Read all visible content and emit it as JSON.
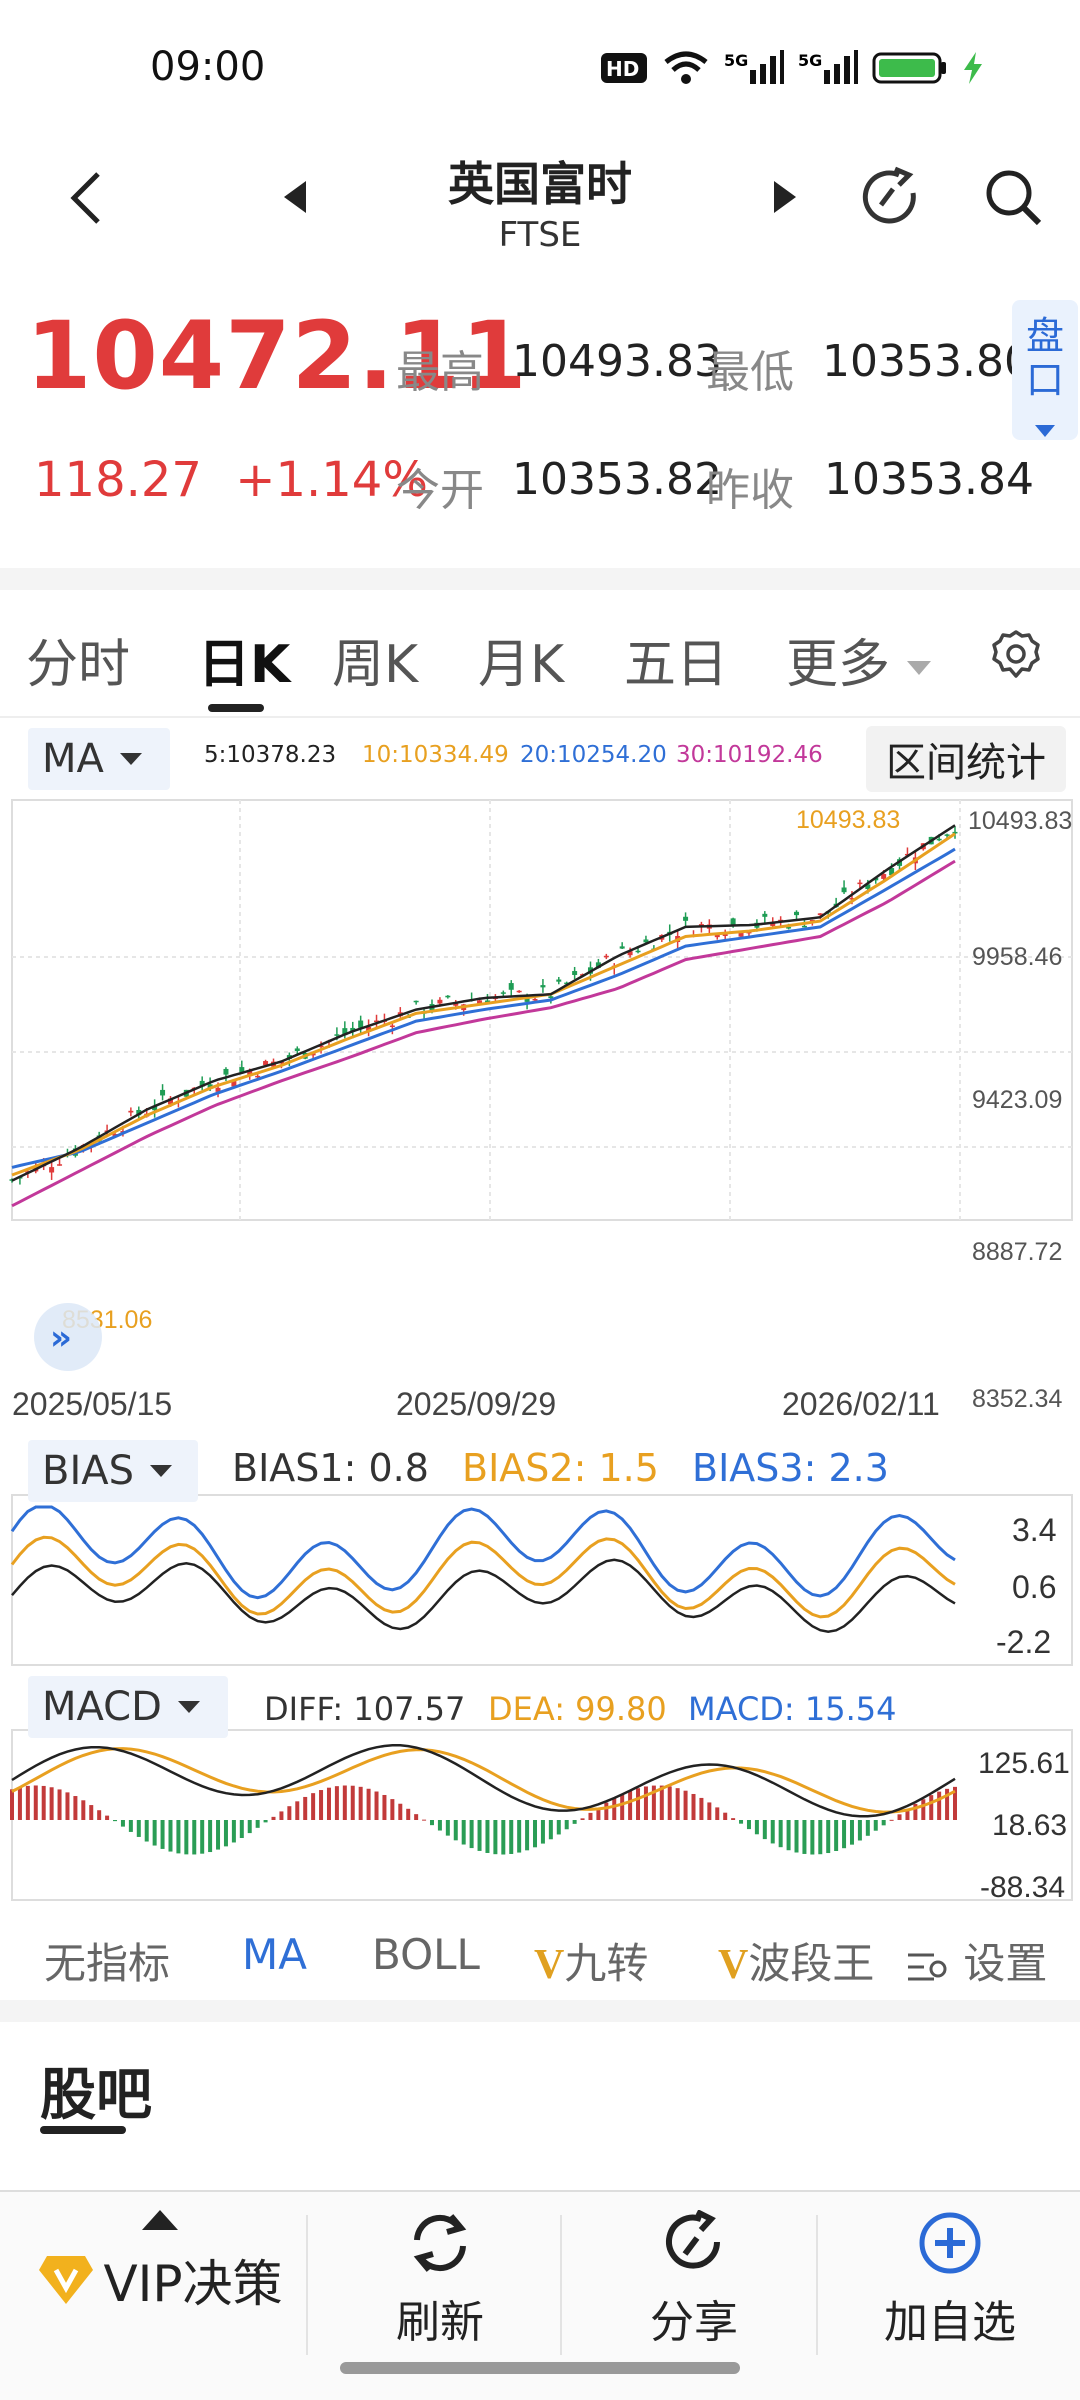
{
  "status_bar": {
    "time": "09:00",
    "hd_label": "HD",
    "net1": "5G",
    "net2": "5G",
    "icons": [
      "hd-icon",
      "wifi-icon",
      "signal-icon",
      "signal-icon",
      "battery-icon",
      "charging-icon"
    ]
  },
  "header": {
    "title": "英国富时",
    "subtitle": "FTSE",
    "icons": [
      "back-icon",
      "prev-icon",
      "next-icon",
      "share-refresh-icon",
      "search-icon"
    ]
  },
  "quote": {
    "price": "10472.11",
    "change": "118.27",
    "change_pct": "+1.14%",
    "high_label": "最高",
    "high": "10493.83",
    "low_label": "最低",
    "low": "10353.80",
    "open_label": "今开",
    "open": "10353.82",
    "prev_close_label": "昨收",
    "prev_close": "10353.84",
    "pankou_label": "盘口",
    "up_color": "#e03b3b"
  },
  "tabs": [
    "分时",
    "日K",
    "周K",
    "月K",
    "五日",
    "更多"
  ],
  "active_tab": "日K",
  "ma_header": {
    "selector": "MA",
    "ma5": "5:10378.23",
    "ma10": "10:10334.49",
    "ma20": "20:10254.20",
    "ma30": "30:10192.46",
    "range_button": "区间统计",
    "colors": {
      "ma5": "#222222",
      "ma10": "#e8a020",
      "ma20": "#2f6fd6",
      "ma30": "#c2389a"
    }
  },
  "kline": {
    "y_ticks": [
      "10493.83",
      "9958.46",
      "9423.09",
      "8887.72",
      "8352.34"
    ],
    "dates": [
      "2025/05/15",
      "2025/09/29",
      "2026/02/11"
    ],
    "max_label": "10493.83",
    "min_label": "8531.06"
  },
  "bias": {
    "selector": "BIAS",
    "bias1": "BIAS1: 0.8",
    "bias2": "BIAS2: 1.5",
    "bias3": "BIAS3: 2.3",
    "ticks": [
      "3.4",
      "0.6",
      "-2.2"
    ]
  },
  "macd": {
    "selector": "MACD",
    "diff": "DIFF: 107.57",
    "dea": "DEA: 99.80",
    "macd": "MACD: 15.54",
    "ticks": [
      "125.61",
      "18.63",
      "-88.34"
    ]
  },
  "indicator_tabs": [
    "无指标",
    "MA",
    "BOLL",
    "九转",
    "波段王",
    "设置"
  ],
  "indicator_v": "V",
  "community": {
    "title": "股吧"
  },
  "bottom_bar": {
    "vip": "VIP决策",
    "refresh": "刷新",
    "share": "分享",
    "add_watch": "加自选"
  },
  "chart_data": {
    "type": "line",
    "title": "",
    "xlabel": "",
    "ylabel": "",
    "x": [
      "2025/05/15",
      "2025/09/29",
      "2026/02/11"
    ],
    "ylim": [
      8352.34,
      10493.83
    ],
    "series": [
      {
        "name": "5",
        "values": [
          8531,
          8700,
          8900,
          9050,
          9150,
          9300,
          9420,
          9480,
          9500,
          9700,
          9850,
          9860,
          9900,
          10150,
          10378
        ]
      },
      {
        "name": "10",
        "values": [
          8560,
          8690,
          8870,
          9020,
          9130,
          9270,
          9400,
          9450,
          9500,
          9650,
          9800,
          9830,
          9880,
          10100,
          10334
        ]
      },
      {
        "name": "20",
        "values": [
          8600,
          8680,
          8830,
          8980,
          9100,
          9230,
          9360,
          9420,
          9470,
          9600,
          9750,
          9800,
          9850,
          10050,
          10254
        ]
      },
      {
        "name": "30",
        "values": [
          8400,
          8580,
          8760,
          8920,
          9050,
          9170,
          9300,
          9370,
          9430,
          9530,
          9680,
          9740,
          9800,
          9980,
          10192
        ]
      }
    ],
    "grid": true
  }
}
